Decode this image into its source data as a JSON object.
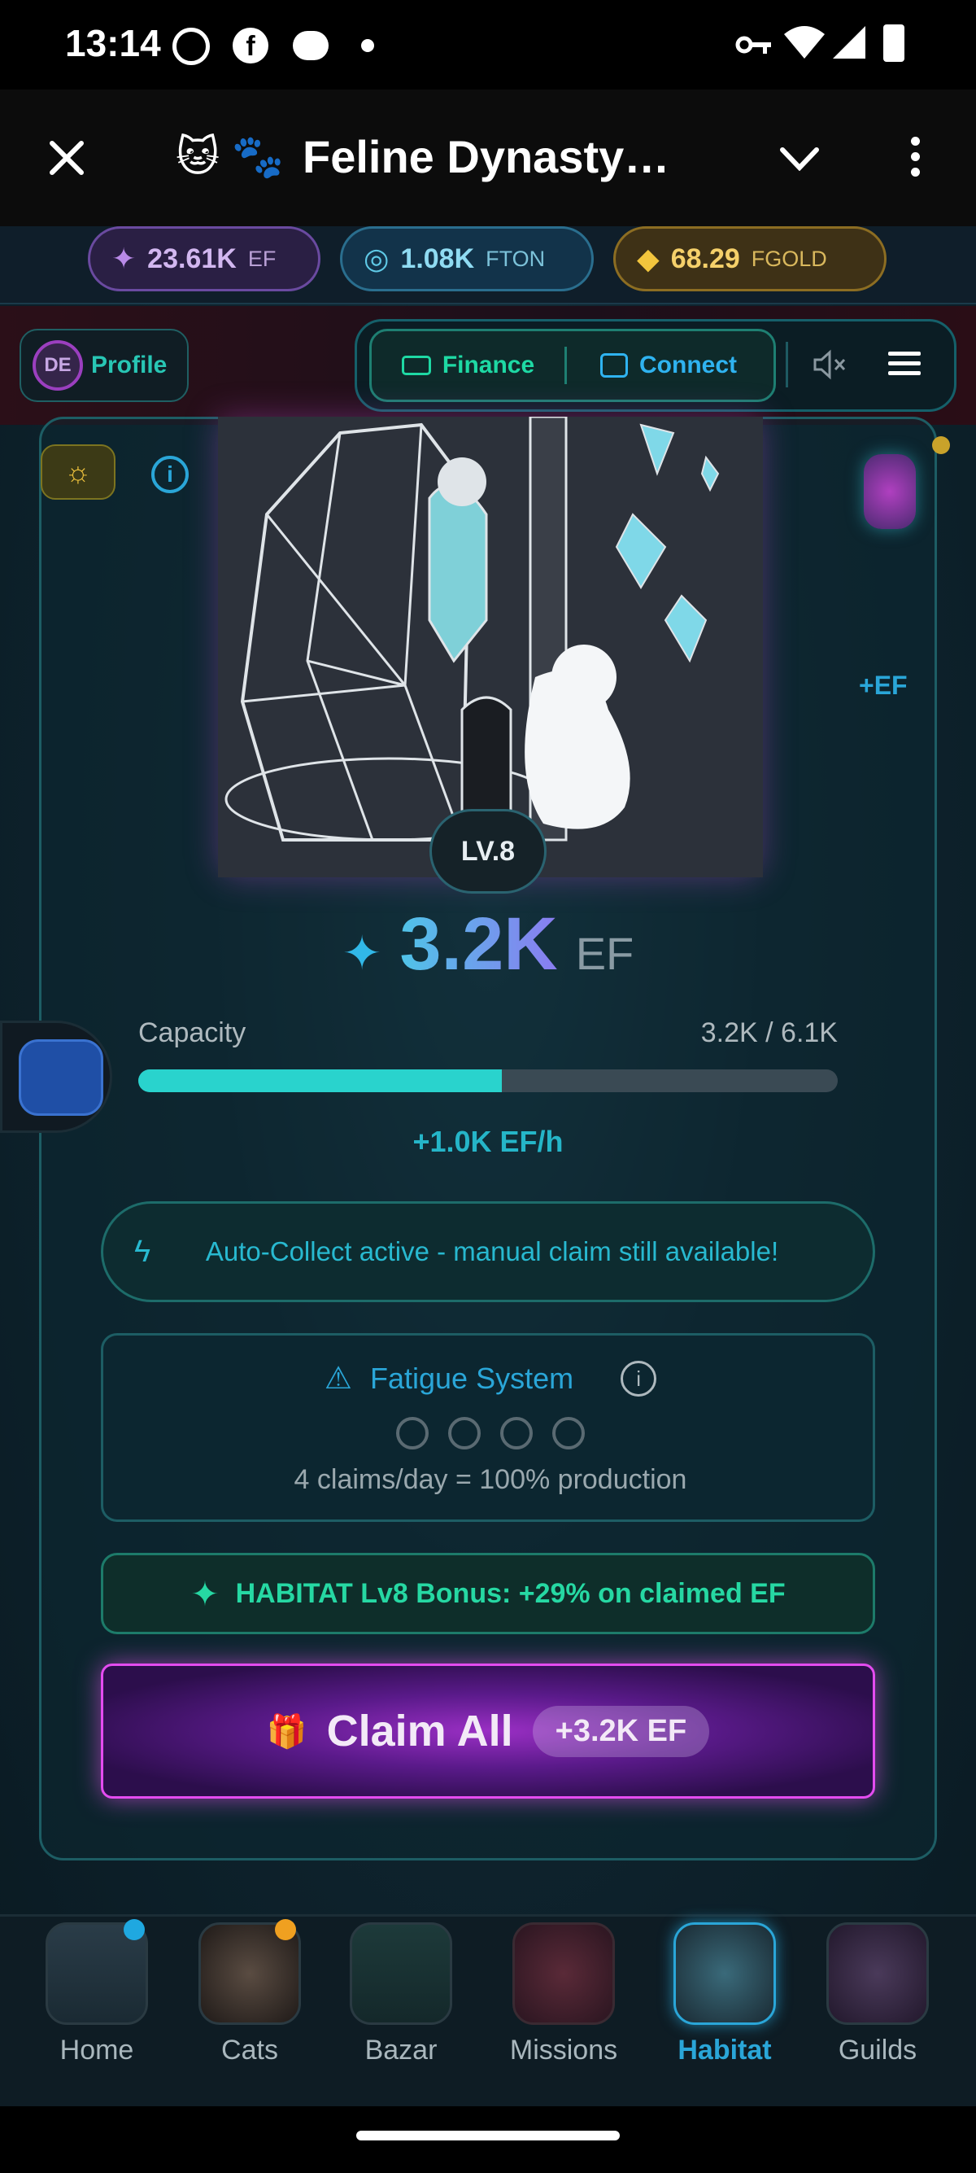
{
  "status": {
    "time": "13:14"
  },
  "appbar": {
    "title": "Feline Dynasty…",
    "title_emoji": "🐱 🐾"
  },
  "resources": [
    {
      "name": "ef",
      "value": "23.61K",
      "unit": "EF",
      "color": "#b98ae8"
    },
    {
      "name": "fton",
      "value": "1.08K",
      "unit": "FTON",
      "color": "#5fc9e6"
    },
    {
      "name": "fgold",
      "value": "68.29",
      "unit": "FGOLD",
      "color": "#f2c53d"
    }
  ],
  "nav": {
    "avatar": "DE",
    "profile": "Profile",
    "finance": "Finance",
    "connect": "Connect"
  },
  "habitat": {
    "level": "LV.8",
    "plus_ef": "+EF",
    "amount": "3.2K",
    "amount_unit": "EF",
    "capacity_label": "Capacity",
    "capacity_value": "3.2K / 6.1K",
    "capacity_fraction": 0.52,
    "rate": "+1.0K EF/h",
    "auto_collect": "Auto-Collect active - manual claim still available!",
    "fatigue_title": "Fatigue System",
    "fatigue_claims": 4,
    "fatigue_text": "4 claims/day = 100% production",
    "bonus": "HABITAT Lv8 Bonus: +29% on claimed EF",
    "claim_label": "Claim All",
    "claim_amount": "+3.2K EF"
  },
  "tabs": [
    {
      "label": "Home",
      "active": false
    },
    {
      "label": "Cats",
      "active": false
    },
    {
      "label": "Bazar",
      "active": false
    },
    {
      "label": "Missions",
      "active": false
    },
    {
      "label": "Habitat",
      "active": true
    },
    {
      "label": "Guilds",
      "active": false
    }
  ]
}
